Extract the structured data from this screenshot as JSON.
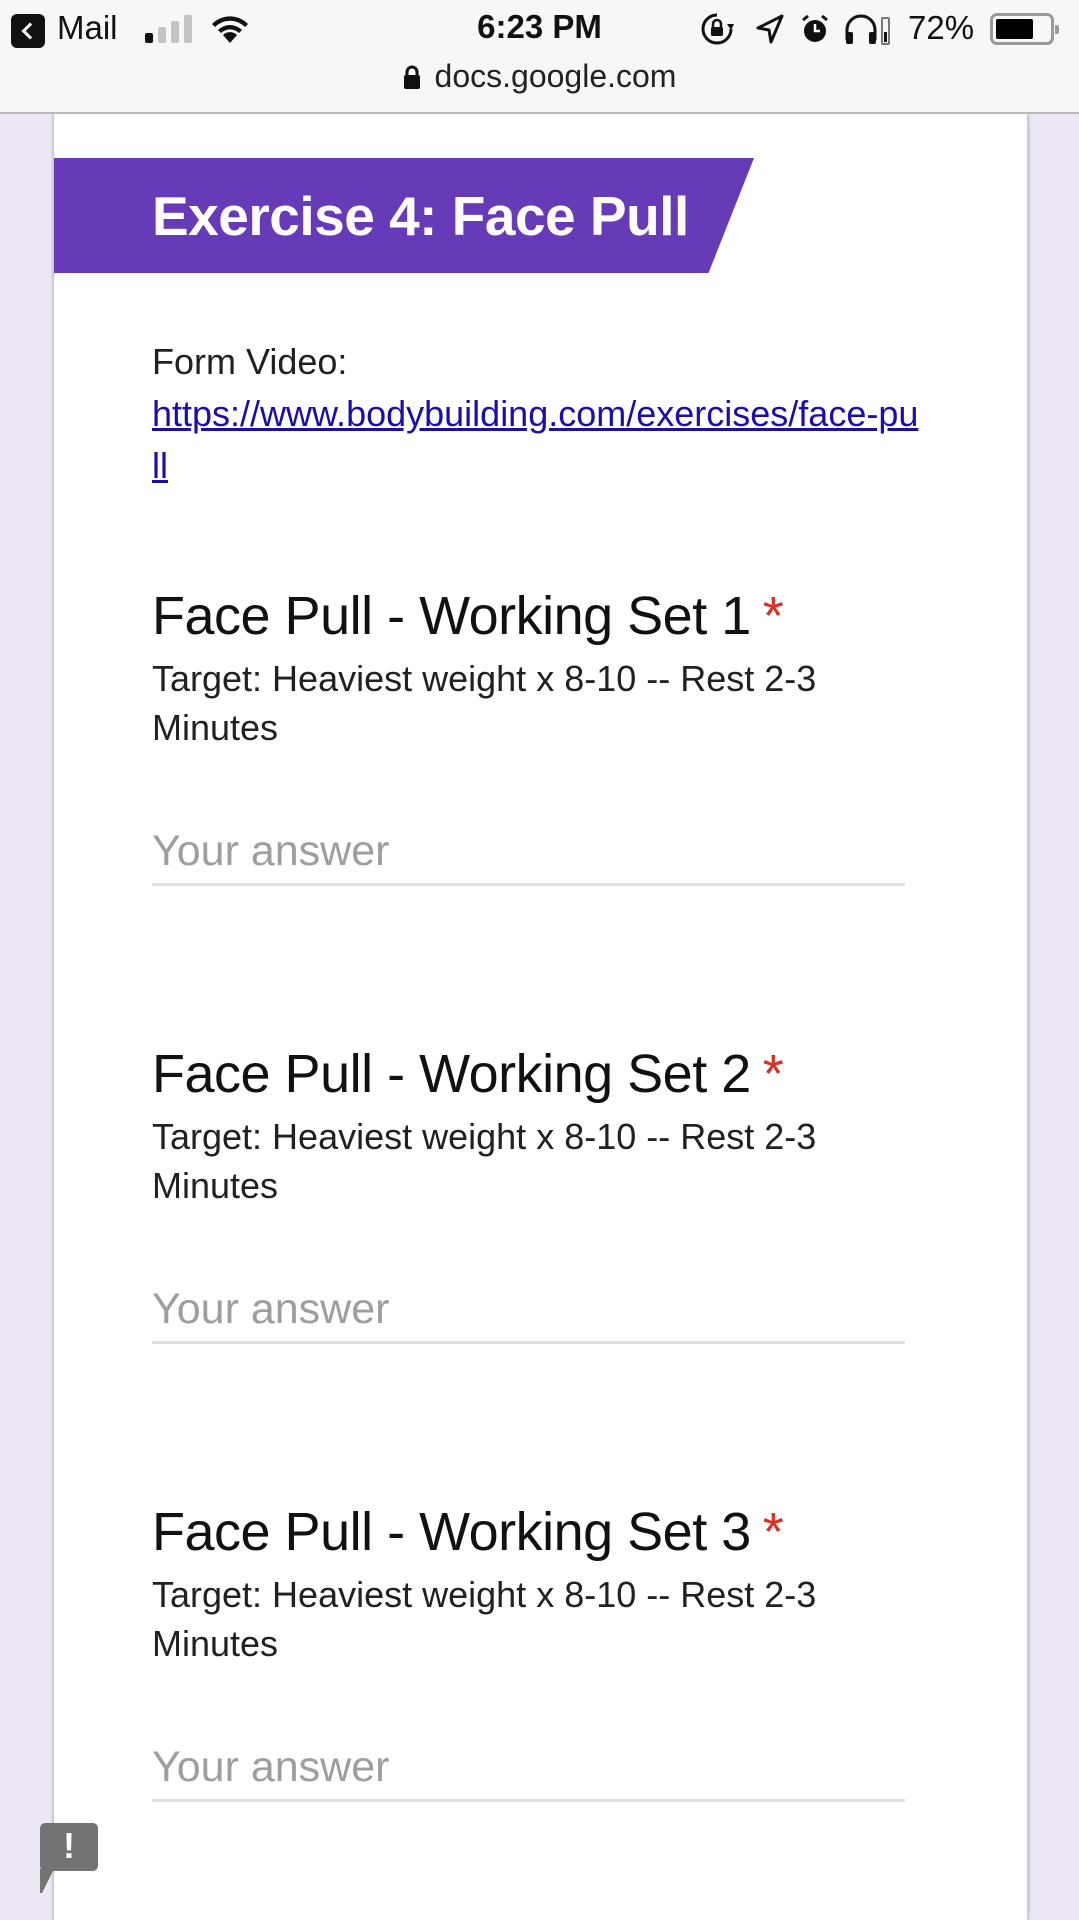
{
  "status_bar": {
    "back_app_label": "Mail",
    "time": "6:23 PM",
    "battery_percent_label": "72%",
    "battery_level": 0.72,
    "signal_bars_active": 1,
    "signal_bars_total": 4,
    "icons": [
      "back-arrow-icon",
      "cellular-signal-icon",
      "wifi-icon",
      "rotation-lock-icon",
      "location-arrow-icon",
      "alarm-clock-icon",
      "headphones-icon",
      "battery-icon"
    ]
  },
  "url_bar": {
    "url": "docs.google.com",
    "secure_icon": "lock-icon"
  },
  "form": {
    "accent_color": "#673ab7",
    "required_color": "#d93025",
    "section_title": "Exercise 4: Face Pull",
    "description_label": "Form Video:",
    "description_link": "https://www.bodybuilding.com/exercises/face-pull",
    "questions": [
      {
        "title": "Face Pull - Working Set 1",
        "required_mark": "*",
        "help_text": "Target: Heaviest weight x 8-10 -- Rest 2-3 Minutes",
        "placeholder": "Your answer",
        "value": ""
      },
      {
        "title": "Face Pull - Working Set 2",
        "required_mark": "*",
        "help_text": "Target: Heaviest weight x 8-10 -- Rest 2-3 Minutes",
        "placeholder": "Your answer",
        "value": ""
      },
      {
        "title": "Face Pull - Working Set 3",
        "required_mark": "*",
        "help_text": "Target: Heaviest weight x 8-10 -- Rest 2-3 Minutes",
        "placeholder": "Your answer",
        "value": ""
      }
    ]
  },
  "feedback_button": {
    "glyph": "!",
    "icon": "report-feedback-icon"
  }
}
